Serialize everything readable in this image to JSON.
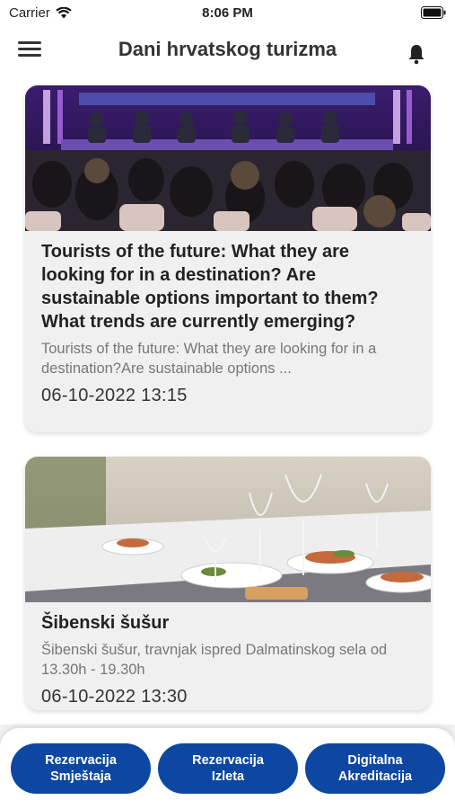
{
  "status_bar": {
    "carrier": "Carrier",
    "time": "8:06 PM"
  },
  "header": {
    "title": "Dani hrvatskog turizma",
    "menu_icon": "hamburger-menu-icon",
    "bell_icon": "bell-icon"
  },
  "feed": {
    "items": [
      {
        "title": "Tourists of the future: What they are looking for in a destination? Are sustainable options important to them? What trends are currently emerging?",
        "excerpt": "Tourists of the future: What they are looking for in a destination?Are sustainable options ...",
        "date": "06-10-2022 13:15"
      },
      {
        "title": "Šibenski šušur",
        "excerpt": "Šibenski šušur, travnjak ispred Dalmatinskog sela od 13.30h - 19.30h",
        "date": "06-10-2022 13:30"
      }
    ]
  },
  "bottom_actions": [
    {
      "label_line1": "Rezervacija",
      "label_line2": "Smještaja"
    },
    {
      "label_line1": "Rezervacija",
      "label_line2": "Izleta"
    },
    {
      "label_line1": "Digitalna",
      "label_line2": "Akreditacija"
    }
  ],
  "colors": {
    "primary": "#0d47a1",
    "background": "#ffffff",
    "card": "#f0f0f0"
  }
}
